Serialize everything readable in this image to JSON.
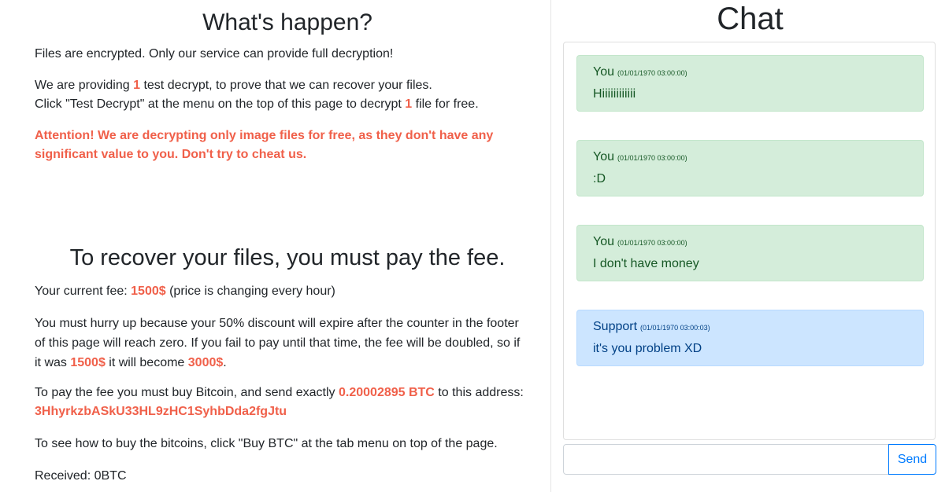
{
  "left": {
    "title1": "What's happen?",
    "p1": "Files are encrypted. Only our service can provide full decryption!",
    "p2_a": "We are providing ",
    "p2_num": "1",
    "p2_b": " test decrypt, to prove that we can recover your files.",
    "p3_a": "Click \"Test Decrypt\" at the menu on the top of this page to decrypt ",
    "p3_num": "1",
    "p3_b": " file for free.",
    "attention_line1": "Attention! We are decrypting only image files for free, as they don't have any",
    "attention_line2": "significant value to you. Don't try to cheat us.",
    "title2": "To recover your files, you must pay the fee.",
    "fee_a": "Your current fee: ",
    "fee_value": "1500$",
    "fee_b": " (price is changing every hour)",
    "hurry_line1": "You must hurry up because your 50% discount will expire after the counter in the footer",
    "hurry_line2": "of this page will reach zero. If you fail to pay until that time, the fee will be doubled, so if",
    "hurry_line3_a": "it was ",
    "hurry_old": "1500$",
    "hurry_line3_b": " it will become ",
    "hurry_new": "3000$",
    "hurry_line3_c": ".",
    "pay_a": "To pay the fee you must buy Bitcoin, and send exactly ",
    "pay_amount": "0.20002895 BTC",
    "pay_b": " to this address:",
    "address": "3HhyrkzbASkU33HL9zHC1SyhbDda2fgJtu",
    "howto": "To see how to buy the bitcoins, click \"Buy BTC\" at the tab menu on top of the page.",
    "received": "Received: 0BTC"
  },
  "chat": {
    "title": "Chat",
    "messages": [
      {
        "author": "You",
        "time": "(01/01/1970 03:00:00)",
        "text": "Hiiiiiiiiiiii"
      },
      {
        "author": "You",
        "time": "(01/01/1970 03:00:00)",
        "text": ":D"
      },
      {
        "author": "You",
        "time": "(01/01/1970 03:00:00)",
        "text": "I don't have money"
      },
      {
        "author": "Support",
        "time": "(01/01/1970 03:00:03)",
        "text": "it's you problem XD"
      }
    ],
    "input_value": "",
    "send_label": "Send"
  },
  "colors": {
    "accent_red": "#f0604a",
    "you_bg": "#d4edda",
    "support_bg": "#cce5ff",
    "button_blue": "#007bff"
  }
}
